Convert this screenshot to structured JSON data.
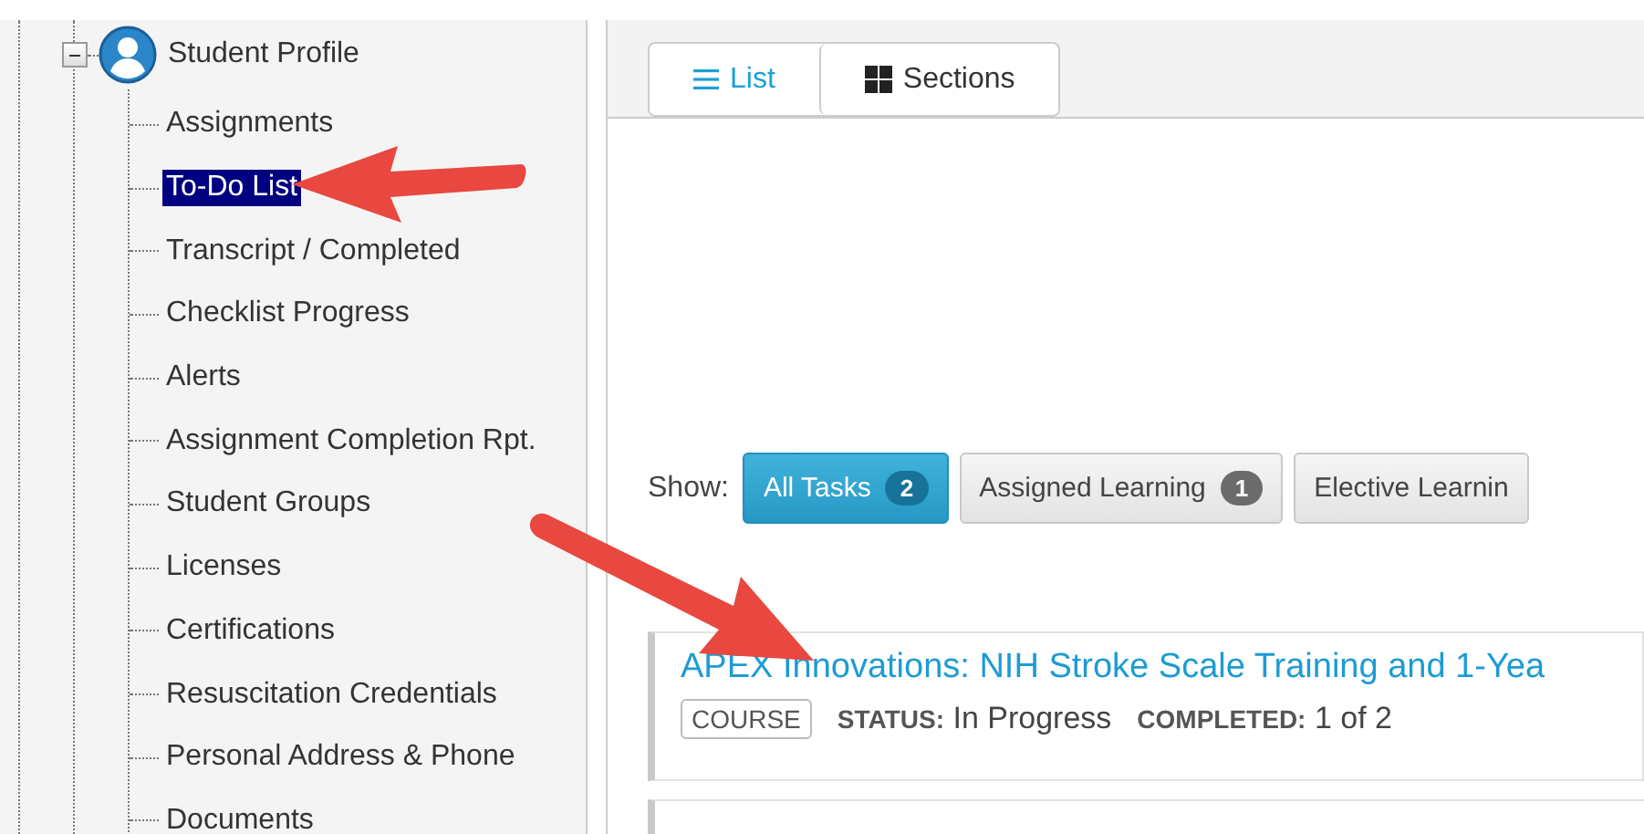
{
  "tree": {
    "root": {
      "label": "Student Profile",
      "expanded": true
    },
    "children": [
      {
        "label": "Assignments",
        "selected": false
      },
      {
        "label": "To-Do List",
        "selected": true
      },
      {
        "label": "Transcript / Completed",
        "selected": false
      },
      {
        "label": "Checklist Progress",
        "selected": false
      },
      {
        "label": "Alerts",
        "selected": false
      },
      {
        "label": "Assignment Completion Rpt.",
        "selected": false
      },
      {
        "label": "Student Groups",
        "selected": false
      },
      {
        "label": "Licenses",
        "selected": false
      },
      {
        "label": "Certifications",
        "selected": false
      },
      {
        "label": "Resuscitation Credentials",
        "selected": false
      },
      {
        "label": "Personal Address & Phone",
        "selected": false
      },
      {
        "label": "Documents",
        "selected": false
      }
    ]
  },
  "view_toggle": [
    {
      "label": "List",
      "kind": "list",
      "selected": true
    },
    {
      "label": "Sections",
      "kind": "sections",
      "selected": false
    }
  ],
  "filter": {
    "label": "Show:",
    "options": [
      {
        "label": "All Tasks",
        "count": "2",
        "selected": true
      },
      {
        "label": "Assigned Learning",
        "count": "1",
        "selected": false
      },
      {
        "label": "Elective Learnin",
        "selected": false
      }
    ]
  },
  "tasks": [
    {
      "title": "APEX Innovations: NIH Stroke Scale Training and 1-Yea",
      "type": "COURSE",
      "status_label": "STATUS:",
      "status": "In Progress",
      "completed_label": "COMPLETED:",
      "completed": "1 of 2"
    }
  ]
}
